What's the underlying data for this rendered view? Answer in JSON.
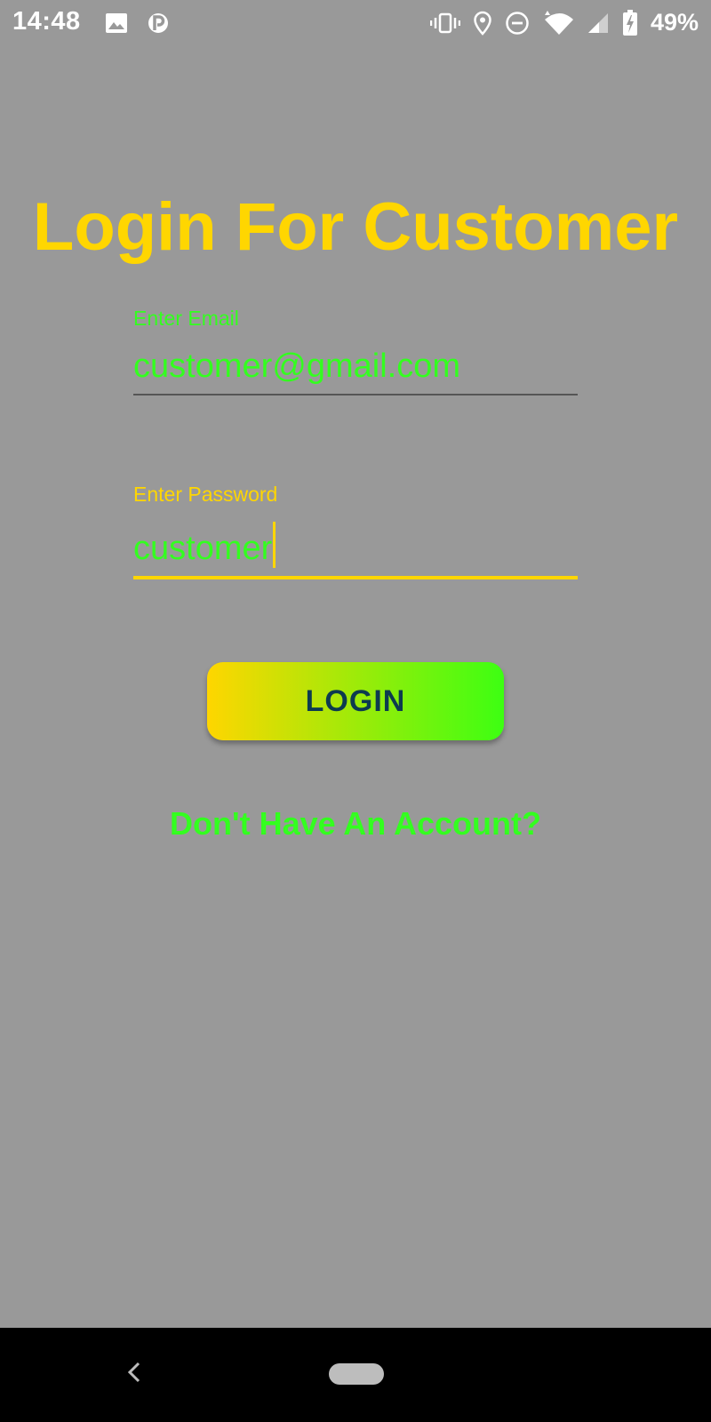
{
  "status_bar": {
    "time": "14:48",
    "battery": "49%",
    "left_icons": [
      "image-icon",
      "parking-icon"
    ],
    "right_icons": [
      "vibrate-icon",
      "location-icon",
      "do-not-disturb-icon",
      "wifi-icon",
      "signal-icon",
      "battery-icon"
    ]
  },
  "login": {
    "title": "Login For Customer",
    "email_label": "Enter Email",
    "email_value": "customer@gmail.com",
    "password_label": "Enter Password",
    "password_value": "customer",
    "button_label": "LOGIN",
    "register_link": "Don't Have An Account?"
  },
  "colors": {
    "background": "#999999",
    "title": "#FFD600",
    "accent_green": "#33ff1f",
    "button_gradient_start": "#FFD600",
    "button_gradient_end": "#3dff12",
    "button_text": "#0d3b4f"
  },
  "nav_bar": {
    "icons": [
      "back-icon",
      "home-pill-icon"
    ]
  }
}
